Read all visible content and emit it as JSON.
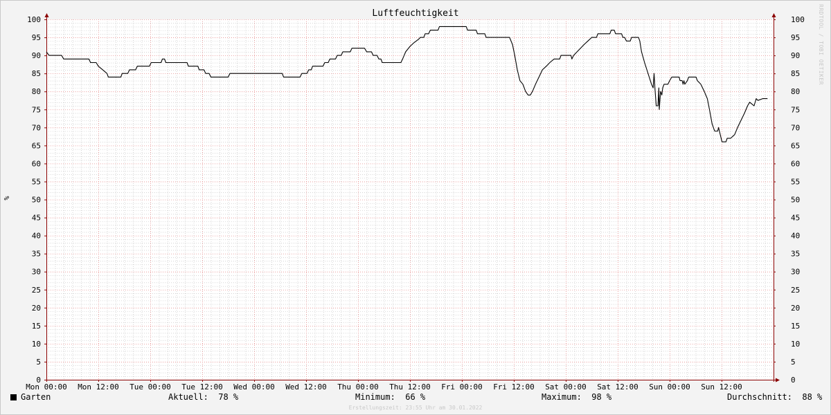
{
  "chart_data": {
    "type": "line",
    "title": "Luftfeuchtigkeit",
    "ylabel": "%",
    "ylim": [
      0,
      100
    ],
    "yticks": [
      0,
      5,
      10,
      15,
      20,
      25,
      30,
      35,
      40,
      45,
      50,
      55,
      60,
      65,
      70,
      75,
      80,
      85,
      90,
      95,
      100
    ],
    "xlim": [
      0,
      168
    ],
    "xtick_hours": [
      0,
      12,
      24,
      36,
      48,
      60,
      72,
      84,
      96,
      108,
      120,
      132,
      144,
      156
    ],
    "xtick_labels": [
      "Mon 00:00",
      "Mon 12:00",
      "Tue 00:00",
      "Tue 12:00",
      "Wed 00:00",
      "Wed 12:00",
      "Thu 00:00",
      "Thu 12:00",
      "Fri 00:00",
      "Fri 12:00",
      "Sat 00:00",
      "Sat 12:00",
      "Sun 00:00",
      "Sun 12:00"
    ],
    "grid": true,
    "series": [
      {
        "name": "Garten",
        "color": "#000000",
        "points": [
          [
            0,
            91
          ],
          [
            0.6,
            90
          ],
          [
            3.5,
            90
          ],
          [
            4,
            89
          ],
          [
            9.8,
            89
          ],
          [
            10.2,
            88
          ],
          [
            11.5,
            88
          ],
          [
            12,
            87
          ],
          [
            13,
            86
          ],
          [
            14,
            85
          ],
          [
            14.3,
            84
          ],
          [
            17.2,
            84
          ],
          [
            17.5,
            85
          ],
          [
            18.8,
            85
          ],
          [
            19.2,
            86
          ],
          [
            20.6,
            86
          ],
          [
            21,
            87
          ],
          [
            23.8,
            87
          ],
          [
            24.2,
            88
          ],
          [
            26.5,
            88
          ],
          [
            26.8,
            89
          ],
          [
            27.3,
            89
          ],
          [
            27.6,
            88
          ],
          [
            32.5,
            88
          ],
          [
            32.8,
            87
          ],
          [
            35,
            87
          ],
          [
            35.3,
            86
          ],
          [
            36.4,
            86
          ],
          [
            36.8,
            85
          ],
          [
            37.6,
            85
          ],
          [
            38,
            84
          ],
          [
            42,
            84
          ],
          [
            42.4,
            85
          ],
          [
            54.5,
            85
          ],
          [
            54.8,
            84
          ],
          [
            58.6,
            84
          ],
          [
            59,
            85
          ],
          [
            60.2,
            85
          ],
          [
            60.6,
            86
          ],
          [
            61.2,
            86
          ],
          [
            61.5,
            87
          ],
          [
            63.9,
            87
          ],
          [
            64.3,
            88
          ],
          [
            65.1,
            88
          ],
          [
            65.5,
            89
          ],
          [
            66.8,
            89
          ],
          [
            67.2,
            90
          ],
          [
            68.1,
            90
          ],
          [
            68.5,
            91
          ],
          [
            70.2,
            91
          ],
          [
            70.6,
            92
          ],
          [
            73.5,
            92
          ],
          [
            74,
            91
          ],
          [
            75.1,
            91
          ],
          [
            75.5,
            90
          ],
          [
            76.4,
            90
          ],
          [
            76.8,
            89
          ],
          [
            77.3,
            89
          ],
          [
            77.6,
            88
          ],
          [
            81.9,
            88
          ],
          [
            82.3,
            89
          ],
          [
            83,
            91
          ],
          [
            84,
            92.5
          ],
          [
            84.9,
            93.5
          ],
          [
            86,
            94.5
          ],
          [
            86.4,
            95
          ],
          [
            87.2,
            95
          ],
          [
            87.5,
            96
          ],
          [
            88.3,
            96
          ],
          [
            88.7,
            97
          ],
          [
            90.5,
            97
          ],
          [
            90.8,
            98
          ],
          [
            97,
            98
          ],
          [
            97.3,
            97
          ],
          [
            99.3,
            97
          ],
          [
            99.6,
            96
          ],
          [
            101.3,
            96
          ],
          [
            101.6,
            95
          ],
          [
            107,
            95
          ],
          [
            107.7,
            93
          ],
          [
            108.2,
            90
          ],
          [
            108.8,
            86
          ],
          [
            109.4,
            83
          ],
          [
            110.1,
            82
          ],
          [
            110.7,
            80
          ],
          [
            111.3,
            79
          ],
          [
            111.8,
            79
          ],
          [
            112.3,
            80
          ],
          [
            113,
            82
          ],
          [
            113.8,
            84
          ],
          [
            114.6,
            86
          ],
          [
            115.5,
            87
          ],
          [
            116.3,
            88
          ],
          [
            117.3,
            89
          ],
          [
            118.6,
            89
          ],
          [
            118.9,
            90
          ],
          [
            121.2,
            90
          ],
          [
            121.4,
            89
          ],
          [
            121.8,
            90
          ],
          [
            122.6,
            91
          ],
          [
            123.4,
            92
          ],
          [
            124.2,
            93
          ],
          [
            125.1,
            94
          ],
          [
            126,
            95
          ],
          [
            127.1,
            95
          ],
          [
            127.4,
            96
          ],
          [
            130.2,
            96
          ],
          [
            130.5,
            97
          ],
          [
            131.2,
            97
          ],
          [
            131.5,
            96
          ],
          [
            132.9,
            96
          ],
          [
            133.2,
            95
          ],
          [
            133.6,
            95
          ],
          [
            134,
            94
          ],
          [
            134.9,
            94
          ],
          [
            135.2,
            95
          ],
          [
            136.8,
            95
          ],
          [
            137.1,
            94
          ],
          [
            137.5,
            91
          ],
          [
            138.2,
            88
          ],
          [
            139,
            85
          ],
          [
            139.8,
            82
          ],
          [
            140.2,
            81
          ],
          [
            140.4,
            85
          ],
          [
            140.6,
            81
          ],
          [
            140.9,
            76
          ],
          [
            141.3,
            76
          ],
          [
            141.5,
            81
          ],
          [
            141.6,
            75
          ],
          [
            141.9,
            80
          ],
          [
            142.2,
            79
          ],
          [
            142.4,
            81
          ],
          [
            142.7,
            82
          ],
          [
            143.6,
            82
          ],
          [
            144,
            83
          ],
          [
            144.5,
            84
          ],
          [
            146.2,
            84
          ],
          [
            146.4,
            83
          ],
          [
            146.9,
            83
          ],
          [
            147.1,
            82
          ],
          [
            147.3,
            83
          ],
          [
            147.5,
            82
          ],
          [
            148.1,
            83
          ],
          [
            148.4,
            84
          ],
          [
            150.1,
            84
          ],
          [
            150.4,
            83
          ],
          [
            151.2,
            82
          ],
          [
            152,
            80
          ],
          [
            152.7,
            78
          ],
          [
            153.2,
            75
          ],
          [
            153.8,
            71
          ],
          [
            154.4,
            69
          ],
          [
            155.1,
            69
          ],
          [
            155.3,
            70
          ],
          [
            155.7,
            68
          ],
          [
            156.1,
            66
          ],
          [
            157,
            66
          ],
          [
            157.3,
            67
          ],
          [
            158.1,
            67
          ],
          [
            159,
            68
          ],
          [
            159.7,
            70
          ],
          [
            160.5,
            72
          ],
          [
            161.3,
            74
          ],
          [
            162,
            76
          ],
          [
            162.5,
            77
          ],
          [
            163,
            76.5
          ],
          [
            163.5,
            76
          ],
          [
            164,
            78
          ],
          [
            164.4,
            77.5
          ],
          [
            165.5,
            78
          ],
          [
            166.6,
            78
          ]
        ]
      }
    ]
  },
  "legend": {
    "series_name": "Garten",
    "current_label": "Aktuell:",
    "current_value": "78 %",
    "min_label": "Minimum:",
    "min_value": "66 %",
    "max_label": "Maximum:",
    "max_value": "98 %",
    "avg_label": "Durchschnitt:",
    "avg_value": "88 %"
  },
  "footer": "Erstellungszeit: 23:55 Uhr am 30.01.2022",
  "watermark": "RRDTOOL / TOBI OETIKER",
  "colors": {
    "background": "#f3f3f3",
    "plot_background": "#ffffff",
    "major_grid": "#e68a8a",
    "minor_grid": "#bcbcbc",
    "axis": "#8b0000",
    "line": "#000000"
  }
}
